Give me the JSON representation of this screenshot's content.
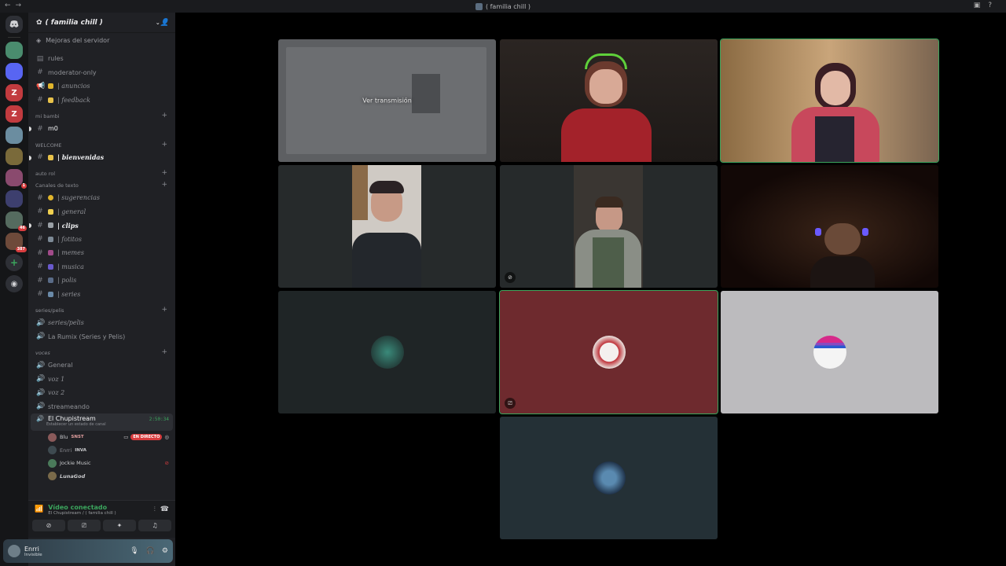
{
  "window": {
    "title": "( familia chill )"
  },
  "server": {
    "name": "( familia chill )",
    "boost_label": "Mejoras del servidor"
  },
  "guilds": [
    {
      "label": "",
      "color": "#4a8c6e"
    },
    {
      "label": "",
      "color": "#5865f2"
    },
    {
      "label": "Z",
      "color": "#c23b3f"
    },
    {
      "label": "Z",
      "color": "#c23b3f"
    },
    {
      "label": "",
      "color": "#6b8da0"
    },
    {
      "label": "",
      "color": "#7a6a3a"
    },
    {
      "label": "",
      "color": "#8a4a6e",
      "badge": "1"
    },
    {
      "label": "",
      "color": "#3d3f6e"
    },
    {
      "label": "",
      "color": "#556b5f",
      "badge": "46"
    },
    {
      "label": "",
      "color": "#6e4a3a",
      "badge": "387"
    }
  ],
  "channels_top": [
    {
      "label": "rules",
      "icon": "rules-icon"
    },
    {
      "label": "moderator-only",
      "icon": "hash-icon"
    },
    {
      "label": "| anuncios",
      "icon": "announcement-icon",
      "fancy": true
    },
    {
      "label": "| feedback",
      "icon": "hash-icon",
      "fancy": true
    }
  ],
  "categories": {
    "mi_bambi": "mi bambi",
    "welcome": "WELCOME",
    "auto_rol": "auto rol",
    "canales": "Canales de texto",
    "series": "series/pelis",
    "voces": "voces"
  },
  "mi_bambi_channels": [
    {
      "label": "m0"
    }
  ],
  "welcome_channels": [
    {
      "label": "| bienvenidas"
    }
  ],
  "text_channels": [
    {
      "label": "| sugerencias"
    },
    {
      "label": "| general"
    },
    {
      "label": "| clips"
    },
    {
      "label": "| fotitos"
    },
    {
      "label": "| memes"
    },
    {
      "label": "| musica"
    },
    {
      "label": "| polis"
    },
    {
      "label": "| series"
    }
  ],
  "series_channels": [
    {
      "label": "series/pelis"
    },
    {
      "label": "La Rumix (Series y Pelis)"
    }
  ],
  "voice_channels": [
    {
      "label": "General"
    },
    {
      "label": "voz 1"
    },
    {
      "label": "voz 2"
    },
    {
      "label": "streameando"
    }
  ],
  "active_voice": {
    "name": "El Chupistream",
    "timer": "2:50:34",
    "status": "Establecer un estado de canal",
    "users": [
      {
        "name": "Blu",
        "tag": "SNST",
        "live": "EN DIRECTO"
      },
      {
        "name": "Enrri",
        "tag": "INVA"
      },
      {
        "name": "Jockie Music"
      },
      {
        "name": "LunaGod"
      }
    ]
  },
  "voice_panel": {
    "connected": "Vídeo conectado",
    "channel": "El Chupistream / ( familia chill )"
  },
  "user": {
    "name": "Enrri",
    "status": "Invisible"
  },
  "stage": {
    "watch_label": "Ver transmisión"
  }
}
